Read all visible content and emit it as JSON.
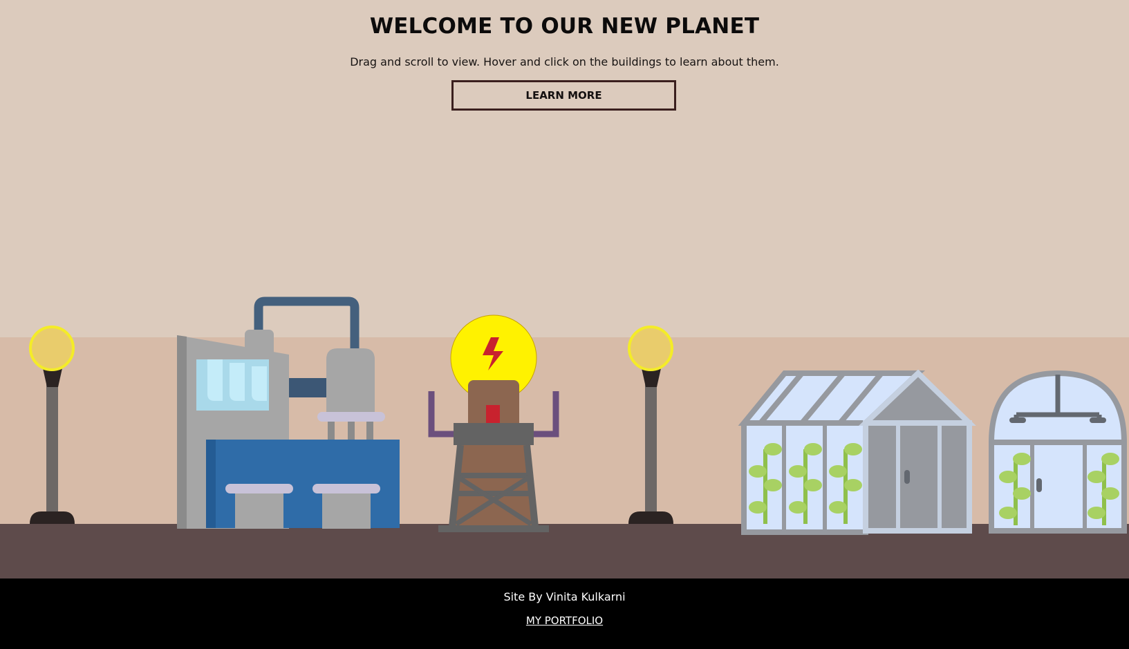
{
  "header": {
    "title": "WELCOME TO OUR NEW PLANET",
    "subtitle": "Drag and scroll to view. Hover and click on the buildings to learn about them.",
    "learn_more_label": "LEARN MORE"
  },
  "scene": {
    "buildings": [
      {
        "name": "factory",
        "icon": "factory-icon"
      },
      {
        "name": "power-tower",
        "icon": "lightning-bolt-icon"
      },
      {
        "name": "greenhouse",
        "icon": "greenhouse-icon"
      },
      {
        "name": "dome-greenhouse",
        "icon": "dome-greenhouse-icon"
      }
    ],
    "street_lamps": 2
  },
  "footer": {
    "credit": "Site By Vinita Kulkarni",
    "portfolio_link": "MY PORTFOLIO"
  },
  "colors": {
    "sky": "#dccbbd",
    "ground_back": "#d7bba8",
    "road": "#5e4b4b",
    "footer": "#000000",
    "button_border": "#3a1f1e",
    "lamp_light": "#e9cc6c",
    "power_orb": "#fff200"
  }
}
